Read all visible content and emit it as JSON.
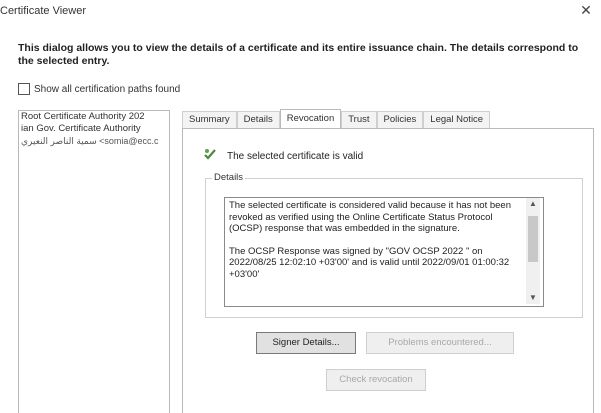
{
  "window": {
    "title": "Certificate Viewer",
    "close_glyph": "✕"
  },
  "intro_text": "This dialog allows you to view the details of a certificate and its entire issuance chain. The details correspond to the selected entry.",
  "show_all_paths": {
    "label": "Show all certification paths found",
    "checked": false
  },
  "chain": [
    "Root Certificate Authority 202",
    "ian Gov. Certificate Authority",
    "سمية الناصر النعيري <somia@ecc.c"
  ],
  "tabs": [
    {
      "label": "Summary",
      "active": false
    },
    {
      "label": "Details",
      "active": false
    },
    {
      "label": "Revocation",
      "active": true
    },
    {
      "label": "Trust",
      "active": false
    },
    {
      "label": "Policies",
      "active": false
    },
    {
      "label": "Legal Notice",
      "active": false
    }
  ],
  "revocation": {
    "status_icon": "valid-certificate-icon",
    "status_text": "The selected certificate is valid",
    "group_label": "Details",
    "details_p1": "The selected certificate is considered valid because it has not been revoked as verified using the Online Certificate Status Protocol (OCSP) response that was embedded in the signature.",
    "details_p2": "The OCSP Response was signed by \"GOV OCSP 2022 \" on 2022/08/25 12:02:10 +03'00' and is valid until 2022/09/01 01:00:32 +03'00'"
  },
  "buttons": {
    "signer_details": "Signer Details...",
    "problems": "Problems encountered...",
    "check_revocation": "Check revocation"
  },
  "colors": {
    "accent_icon": "#4a8a3a",
    "disabled_text": "#a8a8a8"
  }
}
